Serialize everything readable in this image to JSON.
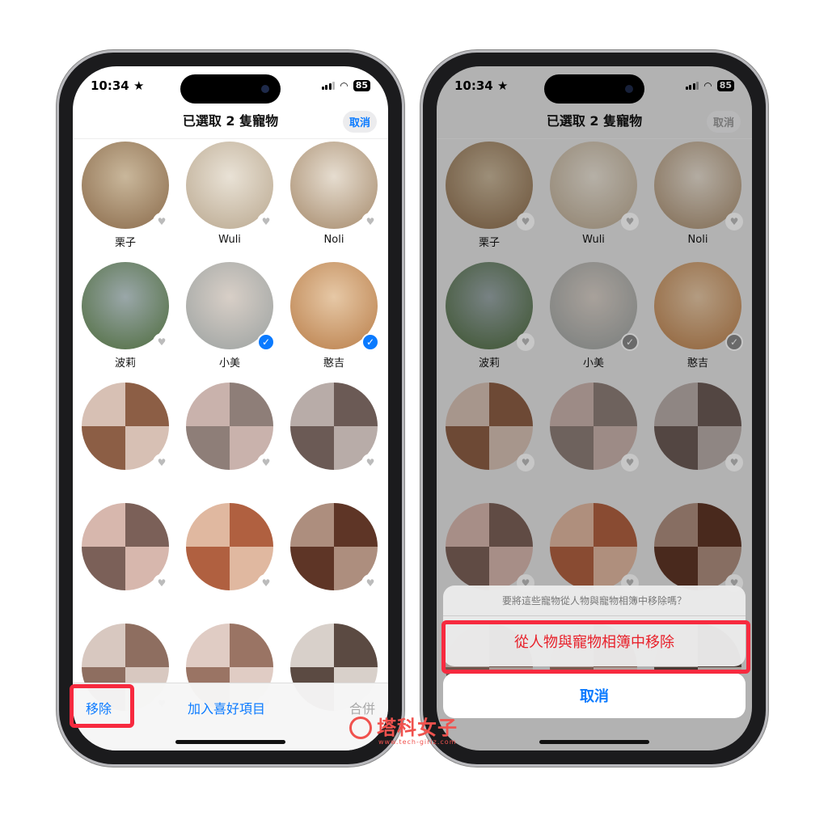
{
  "status": {
    "time": "10:34",
    "battery": "85"
  },
  "nav": {
    "title": "已選取 2 隻寵物",
    "cancel": "取消"
  },
  "pets": [
    {
      "name": "栗子",
      "selected": false,
      "colors": [
        "#8a6a4a",
        "#c9b79b"
      ]
    },
    {
      "name": "Wuli",
      "selected": false,
      "colors": [
        "#b9a78e",
        "#e9e2d6"
      ]
    },
    {
      "name": "Noli",
      "selected": false,
      "colors": [
        "#a5896a",
        "#e6ddd0"
      ]
    },
    {
      "name": "波莉",
      "selected": false,
      "colors": [
        "#4d6b3c",
        "#9aa7a9"
      ]
    },
    {
      "name": "小美",
      "selected": true,
      "colors": [
        "#9ba1a0",
        "#d8cfc7"
      ]
    },
    {
      "name": "憨吉",
      "selected": true,
      "colors": [
        "#b97d48",
        "#e6c8a6"
      ]
    },
    {
      "name": "",
      "selected": false,
      "colors": [
        "#8c5e45",
        "#d7c0b4"
      ]
    },
    {
      "name": "",
      "selected": false,
      "colors": [
        "#8e7e78",
        "#c9b2ac"
      ]
    },
    {
      "name": "",
      "selected": false,
      "colors": [
        "#6b5a55",
        "#b8aca8"
      ]
    },
    {
      "name": "",
      "selected": false,
      "colors": [
        "#7b6058",
        "#d7b7ad"
      ]
    },
    {
      "name": "",
      "selected": false,
      "colors": [
        "#b06040",
        "#e0b8a0"
      ]
    },
    {
      "name": "",
      "selected": false,
      "colors": [
        "#5e3526",
        "#ad8e7e"
      ]
    },
    {
      "name": "",
      "selected": false,
      "colors": [
        "#8e6e60",
        "#d8c8c0"
      ]
    },
    {
      "name": "",
      "selected": false,
      "colors": [
        "#9a7464",
        "#e0ccc4"
      ]
    },
    {
      "name": "",
      "selected": false,
      "colors": [
        "#5b4a42",
        "#d8d0ca"
      ]
    }
  ],
  "toolbar": {
    "remove": "移除",
    "favorite": "加入喜好項目",
    "merge": "合併"
  },
  "sheet": {
    "message": "要將這些寵物從人物與寵物相簿中移除嗎？",
    "remove": "從人物與寵物相簿中移除",
    "cancel": "取消"
  },
  "watermark": {
    "brand": "塔科女子",
    "url": "www.tech-girlz.com"
  },
  "colors": {
    "accent": "#0a7aff",
    "destructive": "#e8202a",
    "highlight": "#f72a3f"
  }
}
